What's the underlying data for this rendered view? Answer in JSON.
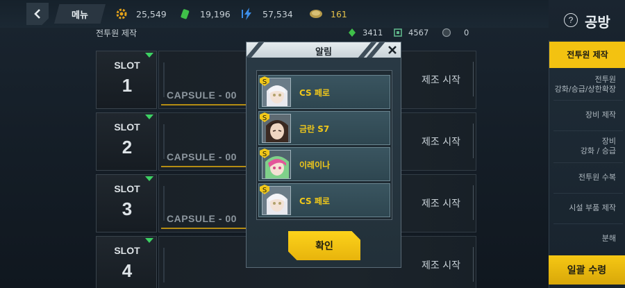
{
  "topbar": {
    "menu_label": "메뉴",
    "resources": [
      {
        "icon": "gear-resource-icon",
        "value": "25,549"
      },
      {
        "icon": "battery-resource-icon",
        "value": "19,196"
      },
      {
        "icon": "lightning-resource-icon",
        "value": "57,534"
      },
      {
        "icon": "coin-resource-icon",
        "value": "161"
      }
    ]
  },
  "subheader": {
    "title": "전투원 제작",
    "resources": [
      {
        "icon": "green-core-icon",
        "value": "3411"
      },
      {
        "icon": "chip-icon",
        "value": "4567"
      },
      {
        "icon": "dark-orb-icon",
        "value": "0"
      }
    ]
  },
  "page_title": "공방",
  "help_label": "?",
  "sidebar": {
    "items": [
      {
        "label": "전투원 제작",
        "active": true
      },
      {
        "label_lines": [
          "전투원",
          "강화/승급/상한확장"
        ]
      },
      {
        "label": "장비 제작"
      },
      {
        "label_lines": [
          "장비",
          "강화 / 승급"
        ]
      },
      {
        "label": "전투원 수복"
      },
      {
        "label": "시설 부품 제작"
      },
      {
        "label": "분해"
      }
    ],
    "collect_all": "일괄 수령"
  },
  "slots": [
    {
      "label": "SLOT",
      "number": "1",
      "capsule": "CAPSULE - 00",
      "action": "제조 시작"
    },
    {
      "label": "SLOT",
      "number": "2",
      "capsule": "CAPSULE - 00",
      "action": "제조 시작"
    },
    {
      "label": "SLOT",
      "number": "3",
      "capsule": "CAPSULE - 00",
      "action": "제조 시작"
    },
    {
      "label": "SLOT",
      "number": "4",
      "capsule": "",
      "action": "제조 시작"
    }
  ],
  "modal": {
    "title": "알림",
    "close": "✕",
    "items": [
      {
        "name": "CS 페로",
        "rank": "S"
      },
      {
        "name": "금란 S7",
        "rank": "S"
      },
      {
        "name": "이레이나",
        "rank": "S"
      },
      {
        "name": "CS 페로",
        "rank": "S"
      }
    ],
    "confirm": "확인"
  },
  "colors": {
    "accent_yellow": "#f3c211",
    "name_yellow": "#f1c81a",
    "slot_marker_green": "#3dd163",
    "panel_dark": "#1a2128"
  }
}
